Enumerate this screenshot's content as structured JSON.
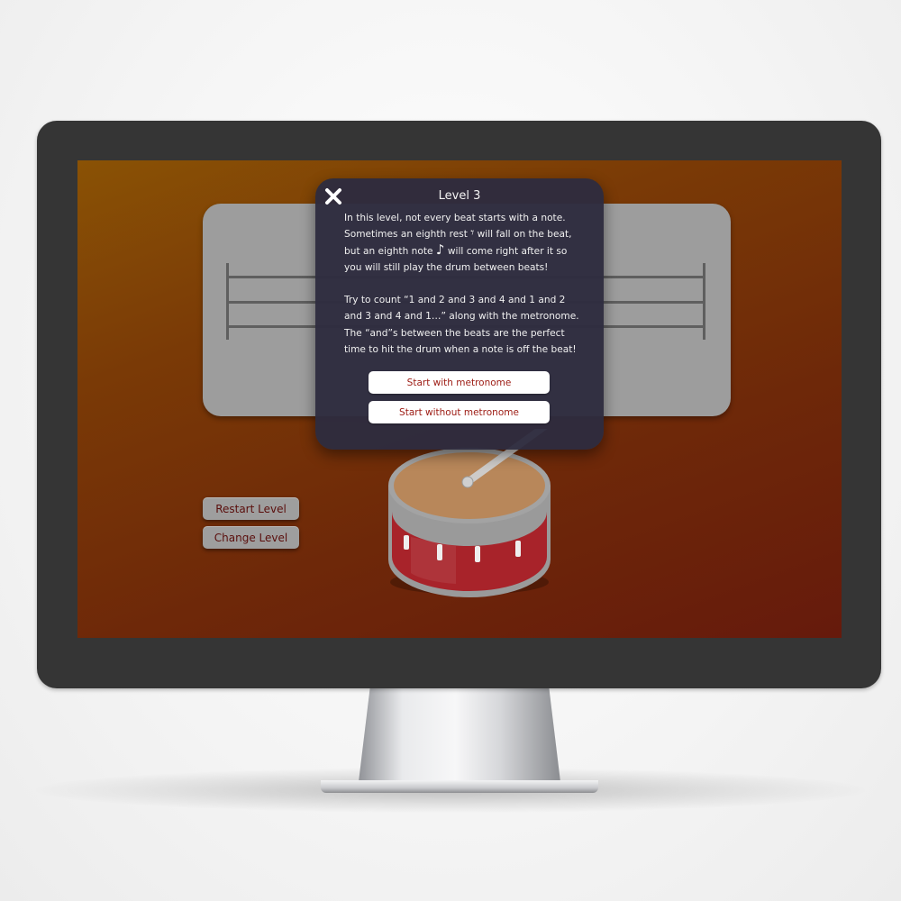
{
  "modal": {
    "title": "Level 3",
    "paragraph1_parts": [
      "In this level, not every beat starts with a note. Sometimes an eighth rest ",
      " will fall on the beat, but an eighth note ",
      " will come right after it so you will still play the drum between beats!"
    ],
    "paragraph2": "Try to count “1 and 2 and 3 and 4 and 1 and 2 and 3 and 4 and 1…” along with the metronome. The “and”s between the beats are the perfect time to hit the drum when a note is off the beat!",
    "start_with_metronome": "Start with metronome",
    "start_without_metronome": "Start without metronome",
    "close_icon": "close-icon",
    "eighth_rest_icon": "eighth-rest-icon",
    "eighth_note_icon": "eighth-note-icon"
  },
  "controls": {
    "restart_level": "Restart Level",
    "change_level": "Change Level"
  },
  "colors": {
    "background_top": "#8a5205",
    "background_bottom": "#661a0c",
    "modal_bg": "#2e2c3e",
    "button_text": "#9c1a12",
    "drum_shell": "#a8232a",
    "drum_head": "#b8875a"
  }
}
